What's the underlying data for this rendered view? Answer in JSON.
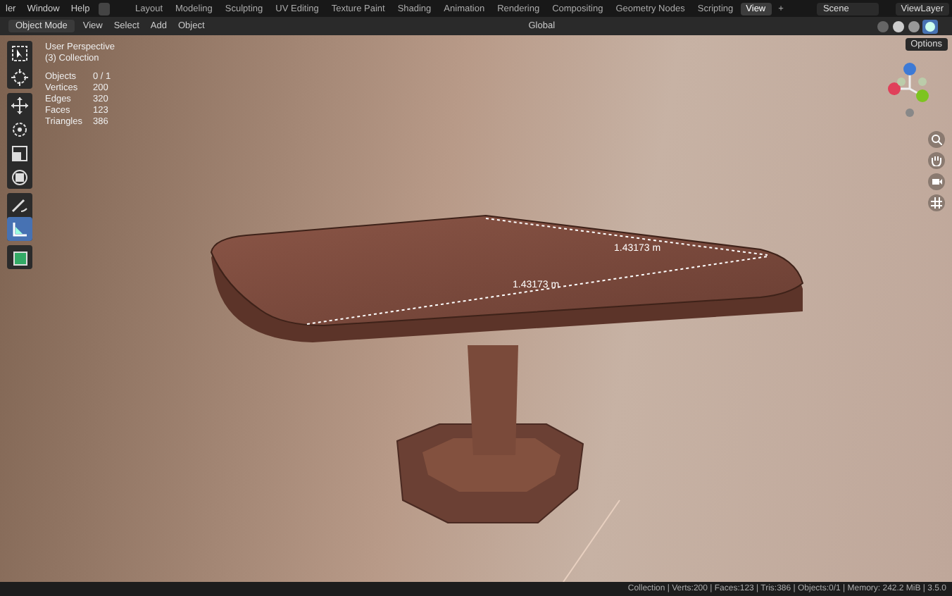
{
  "top_bar": {
    "menus": [
      "ler",
      "Window",
      "Help"
    ],
    "workspace_tabs": [
      {
        "label": "Layout",
        "selected": false
      },
      {
        "label": "Modeling",
        "selected": false
      },
      {
        "label": "Sculpting",
        "selected": false
      },
      {
        "label": "UV Editing",
        "selected": false
      },
      {
        "label": "Texture Paint",
        "selected": false
      },
      {
        "label": "Shading",
        "selected": false
      },
      {
        "label": "Animation",
        "selected": false
      },
      {
        "label": "Rendering",
        "selected": false
      },
      {
        "label": "Compositing",
        "selected": false
      },
      {
        "label": "Geometry Nodes",
        "selected": false
      },
      {
        "label": "Scripting",
        "selected": false
      },
      {
        "label": "View",
        "selected": true
      }
    ],
    "add_tab": "+",
    "scene": "Scene",
    "view_layer": "ViewLayer"
  },
  "header": {
    "mode": "Object Mode",
    "menus": [
      "View",
      "Select",
      "Add",
      "Object"
    ],
    "orientation": "Global",
    "options": "Options"
  },
  "toolbar": [
    {
      "kind": "select",
      "selected": false
    },
    {
      "kind": "cursor",
      "selected": false
    },
    {
      "kind": "move",
      "selected": false
    },
    {
      "kind": "rotate",
      "selected": false
    },
    {
      "kind": "scale",
      "selected": false
    },
    {
      "kind": "transform",
      "selected": false
    },
    {
      "kind": "annotate",
      "selected": false
    },
    {
      "kind": "measure",
      "selected": true
    },
    {
      "kind": "add-cube",
      "selected": false
    }
  ],
  "viewport": {
    "view_name": "User Perspective",
    "collection": "(3) Collection",
    "stats": [
      {
        "label": "Objects",
        "value": "0 / 1"
      },
      {
        "label": "Vertices",
        "value": "200"
      },
      {
        "label": "Edges",
        "value": "320"
      },
      {
        "label": "Faces",
        "value": "123"
      },
      {
        "label": "Triangles",
        "value": "386"
      }
    ],
    "measurements": [
      "1.43173 m",
      "1.43173 m"
    ]
  },
  "status_bar": "Collection | Verts:200 | Faces:123 | Tris:386 | Objects:0/1 | Memory: 242.2 MiB | 3.5.0"
}
